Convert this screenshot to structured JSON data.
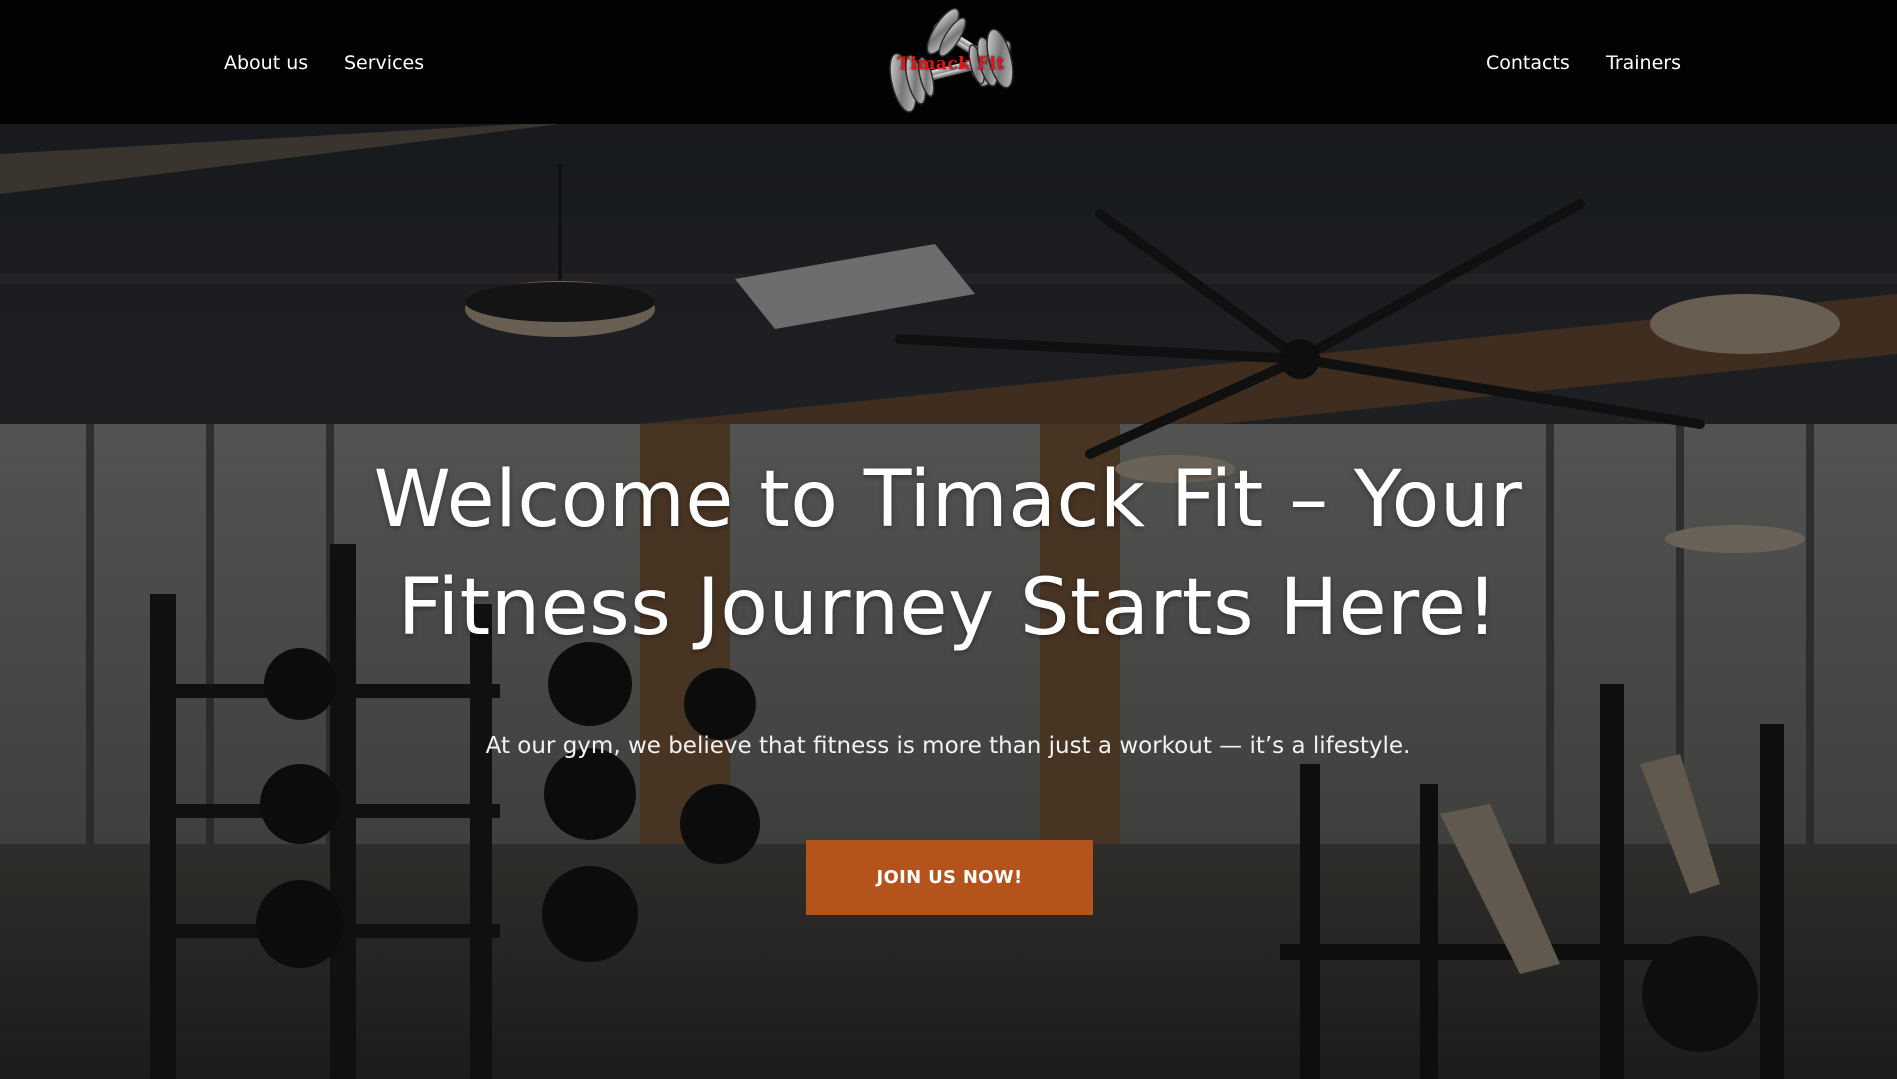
{
  "header": {
    "nav_left": [
      "About us",
      "Services"
    ],
    "nav_right": [
      "Contacts",
      "Trainers"
    ],
    "logo_text": "Timack Fit"
  },
  "hero": {
    "title_line1": "Welcome to Timack Fit – Your",
    "title_line2": "Fitness Journey Starts Here!",
    "subtitle": "At our gym, we believe that fitness is more than just a workout — it’s a lifestyle.",
    "cta_label": "JOIN US NOW!"
  },
  "colors": {
    "header_bg": "#020202",
    "cta_bg": "#b4541c",
    "logo_text": "#e01717"
  },
  "icons": {
    "logo": "dumbbell-logo-icon"
  }
}
